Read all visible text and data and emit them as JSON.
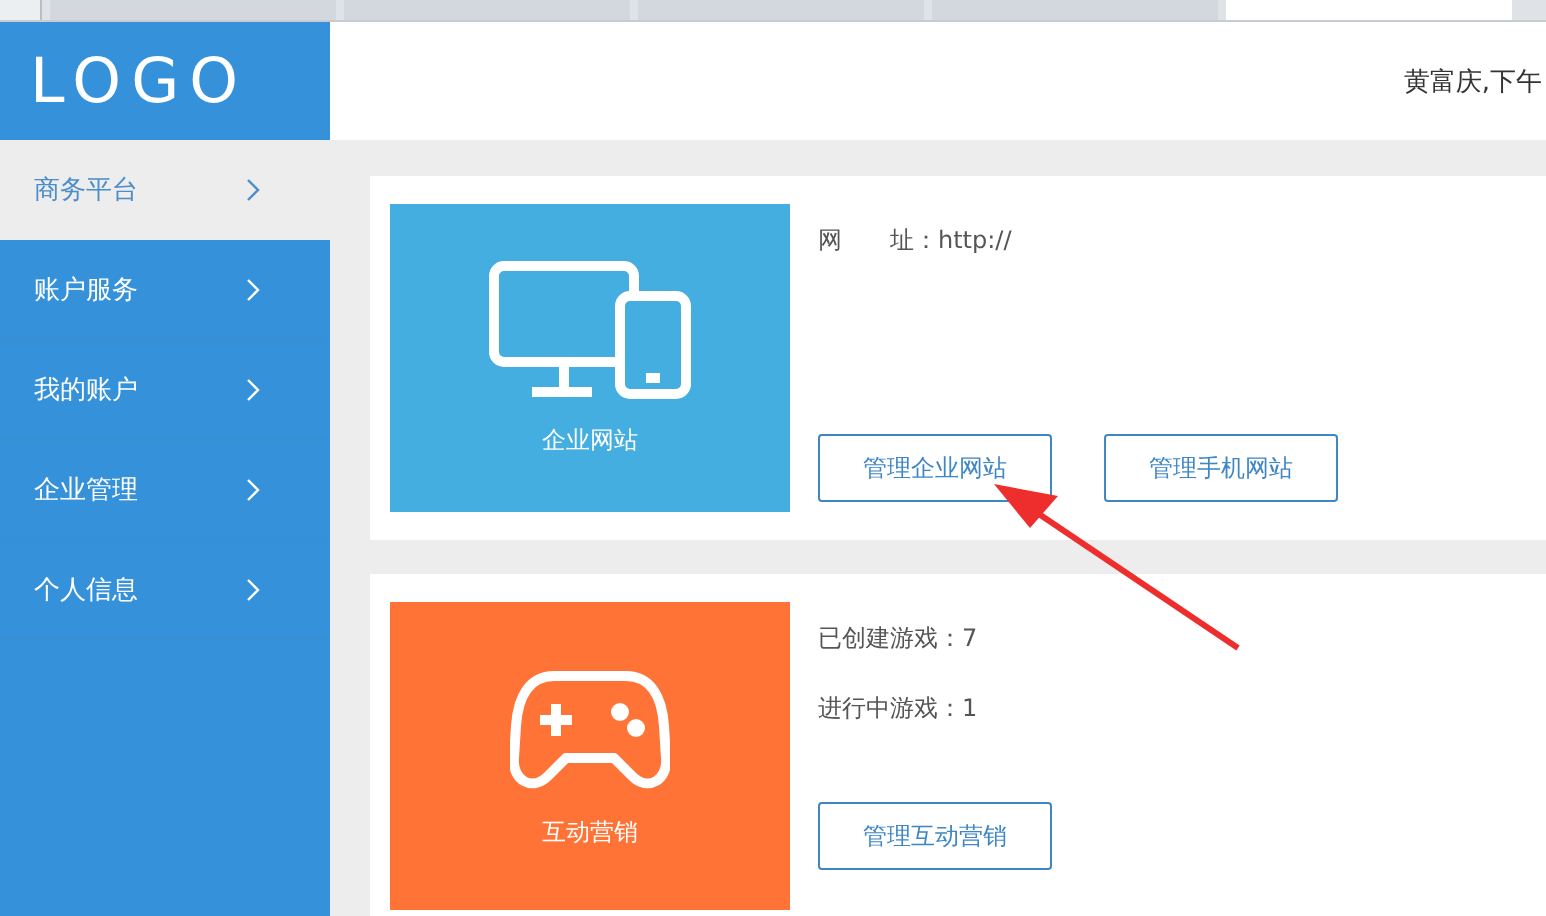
{
  "browser_tabs": [
    {
      "selected": false
    },
    {
      "selected": false
    },
    {
      "selected": false
    },
    {
      "selected": false
    },
    {
      "selected": true
    }
  ],
  "header": {
    "logo": "LOGO",
    "greeting": "黄富庆,下午"
  },
  "sidebar": {
    "items": [
      {
        "label": "商务平台",
        "selected": true
      },
      {
        "label": "账户服务",
        "selected": false
      },
      {
        "label": "我的账户",
        "selected": false
      },
      {
        "label": "企业管理",
        "selected": false
      },
      {
        "label": "个人信息",
        "selected": false
      }
    ]
  },
  "cards": [
    {
      "kind": "website",
      "tile_label": "企业网站",
      "color": "#45aee1",
      "lines": [
        "网　　址：http://"
      ],
      "buttons": [
        "管理企业网站",
        "管理手机网站"
      ]
    },
    {
      "kind": "game",
      "tile_label": "互动营销",
      "color": "#ff7337",
      "lines": [
        "已创建游戏：7",
        "进行中游戏：1"
      ],
      "buttons": [
        "管理互动营销"
      ]
    }
  ]
}
